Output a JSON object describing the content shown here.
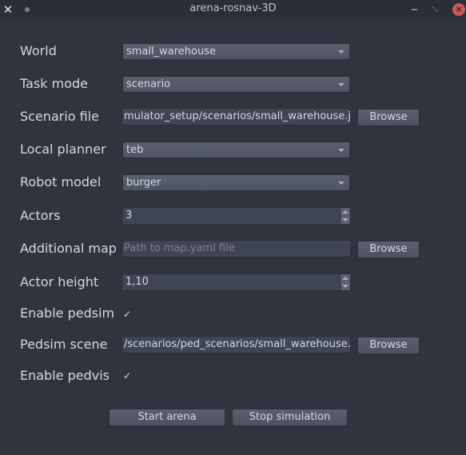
{
  "window": {
    "title": "arena-rosnav-3D",
    "left_icon": "close-x-icon",
    "pin_icon": "dot-icon",
    "controls": [
      "minimize-icon",
      "maximize-icon",
      "close-icon"
    ],
    "close_glyph": "×",
    "left_glyph": "✕",
    "max_glyph": "⤡"
  },
  "form": {
    "world": {
      "label": "World",
      "value": "small_warehouse"
    },
    "task_mode": {
      "label": "Task mode",
      "value": "scenario"
    },
    "scenario_file": {
      "label": "Scenario file",
      "value": "mulator_setup/scenarios/small_warehouse.json",
      "button": "Browse"
    },
    "local_planner": {
      "label": "Local planner",
      "value": "teb"
    },
    "robot_model": {
      "label": "Robot model",
      "value": "burger"
    },
    "actors": {
      "label": "Actors",
      "value": "3"
    },
    "additional_map": {
      "label": "Additional map",
      "value": "",
      "placeholder": "Path to map.yaml file",
      "button": "Browse"
    },
    "actor_height": {
      "label": "Actor height",
      "value": "1,10"
    },
    "enable_pedsim": {
      "label": "Enable pedsim",
      "checked": true,
      "glyph": "✓"
    },
    "pedsim_scene": {
      "label": "Pedsim scene",
      "value": "/scenarios/ped_scenarios/small_warehouse.xml",
      "button": "Browse"
    },
    "enable_pedvis": {
      "label": "Enable pedvis",
      "checked": true,
      "glyph": "✓"
    }
  },
  "actions": {
    "start": "Start arena",
    "stop": "Stop simulation"
  }
}
